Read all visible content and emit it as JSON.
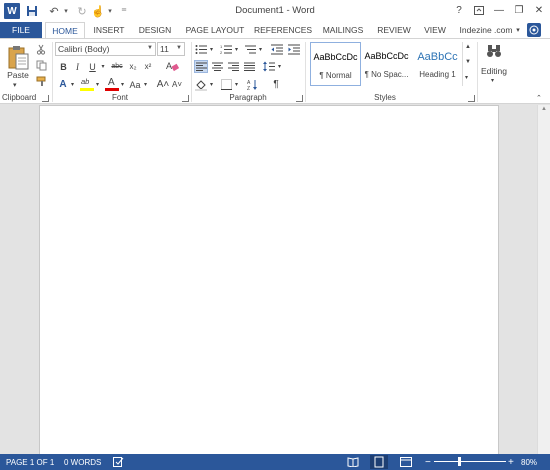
{
  "window": {
    "title": "Document1 - Word",
    "help": "?",
    "minimize": "—",
    "restore": "❐",
    "close": "✕"
  },
  "qat": {
    "app_letter": "W",
    "save": "💾",
    "undo": "↶",
    "redo": "↻",
    "touch": "☝",
    "customize": "⁼"
  },
  "tabs": [
    "FILE",
    "HOME",
    "INSERT",
    "DESIGN",
    "PAGE LAYOUT",
    "REFERENCES",
    "MAILINGS",
    "REVIEW",
    "VIEW"
  ],
  "account": {
    "name": "Indezine .com",
    "dropdown": "▾"
  },
  "clipboard": {
    "paste_label": "Paste",
    "group_label": "Clipboard"
  },
  "font": {
    "font_name": "Calibri (Body)",
    "font_size": "11",
    "grow": "A",
    "shrink": "A",
    "change_case": "Aa",
    "bold": "B",
    "italic": "I",
    "underline": "U",
    "strike": "abc",
    "subscript": "x₂",
    "superscript": "x²",
    "text_effects": "A",
    "highlight": "ab",
    "font_color": "A",
    "grow_font": "A˄",
    "shrink_font": "A˅",
    "group_label": "Font"
  },
  "paragraph": {
    "pilcrow": "¶",
    "group_label": "Paragraph"
  },
  "styles": {
    "items": [
      {
        "sample": "AaBbCcDc",
        "name": "¶ Normal"
      },
      {
        "sample": "AaBbCcDc",
        "name": "¶ No Spac..."
      },
      {
        "sample": "AaBbCc",
        "name": "Heading 1"
      }
    ],
    "group_label": "Styles"
  },
  "editing": {
    "label": "Editing"
  },
  "status": {
    "page": "PAGE 1 OF 1",
    "words": "0 WORDS",
    "zoom": "80%",
    "zoom_minus": "−",
    "zoom_plus": "+"
  },
  "colors": {
    "accent": "#2b579a",
    "highlight_yellow": "#ffff00",
    "font_red": "#e00000"
  }
}
